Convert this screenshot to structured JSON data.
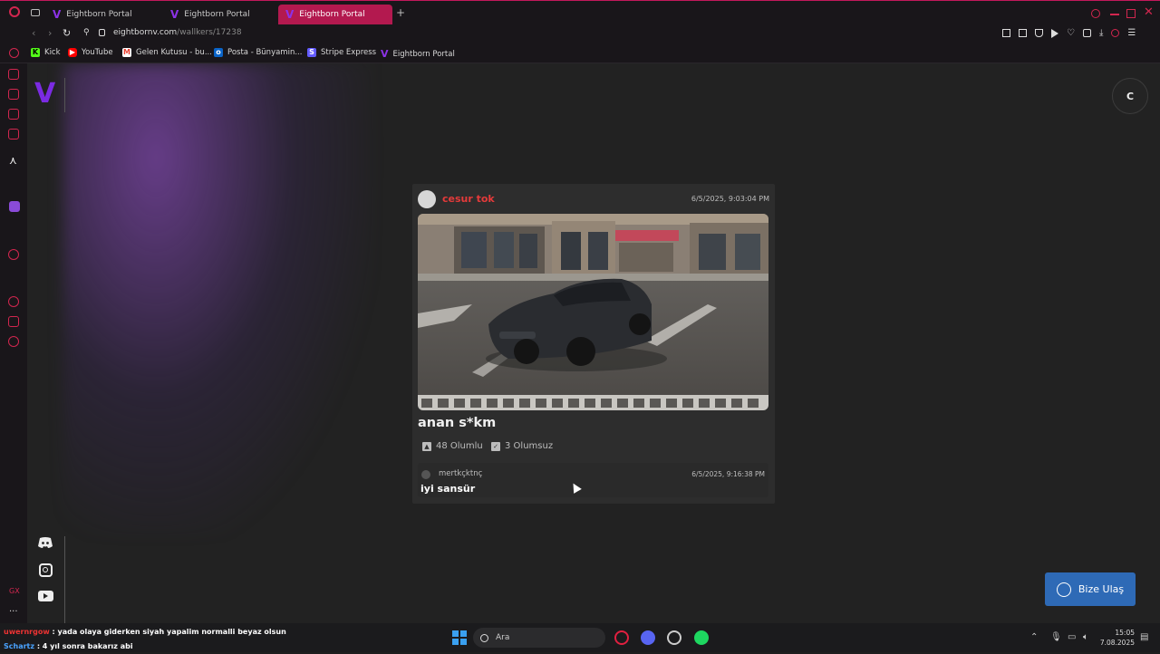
{
  "browser": {
    "tabs": [
      {
        "label": "Eightborn Portal"
      },
      {
        "label": "Eightborn Portal"
      },
      {
        "label": "Eightborn Portal"
      }
    ],
    "new_tab_label": "+",
    "url_domain": "eightbornv.com",
    "url_path": "/wallkers/17238",
    "bookmarks": [
      {
        "label": "Kick",
        "icon": "kick-icon",
        "color": "#53fc18"
      },
      {
        "label": "YouTube",
        "icon": "youtube-icon",
        "color": "#ff0000"
      },
      {
        "label": "Gelen Kutusu - bu...",
        "icon": "gmail-icon",
        "color": "#ea4335"
      },
      {
        "label": "Posta - Bünyamin...",
        "icon": "outlook-icon",
        "color": "#0a64c8"
      },
      {
        "label": "Stripe Express",
        "icon": "stripe-icon",
        "color": "#635bff"
      },
      {
        "label": "Eightborn Portal",
        "icon": "eightborn-icon",
        "color": "#8c32e6"
      }
    ]
  },
  "site": {
    "logo_text": "V",
    "avatar_initial": "C",
    "contact_button": "Bize Ulaş",
    "accent": "#7b2be2"
  },
  "post": {
    "username": "cesur tok",
    "date": "6/5/2025, 9:03:04 PM",
    "title": "anan s*km",
    "upvotes": "48 Olumlu",
    "downvotes": "3 Olumsuz",
    "comment": {
      "username": "mertkçktnç",
      "date": "6/5/2025, 9:16:38 PM",
      "text": "iyi sansür"
    }
  },
  "taskbar": {
    "chat_lines": [
      {
        "user": "uwernrgow",
        "text": " : yada olaya giderken siyah yapalim normalli beyaz olsun"
      },
      {
        "user": "Schartz",
        "text": " : 4 yıl sonra bakarız abi"
      }
    ],
    "search_placeholder": "Ara",
    "time": "15:05",
    "date": "7.08.2025"
  }
}
